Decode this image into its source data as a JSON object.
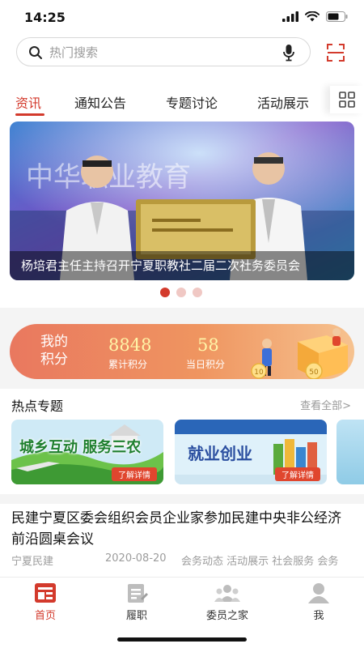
{
  "status": {
    "time": "14:25"
  },
  "search": {
    "placeholder": "热门搜索"
  },
  "tabs": [
    {
      "label": "资讯",
      "active": true
    },
    {
      "label": "通知公告",
      "active": false
    },
    {
      "label": "专题讨论",
      "active": false
    },
    {
      "label": "活动展示",
      "active": false
    }
  ],
  "banner": {
    "caption": "杨培君主任主持召开宁夏职教社二届二次社务委员会",
    "slide_count": 3,
    "active_slide": 1,
    "backdrop_text": "中华职业教育"
  },
  "points": {
    "label_line1": "我的",
    "label_line2": "积分",
    "total_value": "8848",
    "total_label": "累计积分",
    "today_value": "58",
    "today_label": "当日积分",
    "coin_10": "10",
    "coin_50": "50"
  },
  "hot": {
    "title": "热点专题",
    "more": "查看全部>",
    "cards": [
      {
        "title": "城乡互动 服务三农",
        "detail": "了解详情"
      },
      {
        "title": "就业创业",
        "detail": "了解详情"
      }
    ]
  },
  "news": {
    "title": "民建宁夏区委会组织会员企业家参加民建中央非公经济前沿圆桌会议",
    "source": "宁夏民建",
    "date": "2020-08-20",
    "tags": "会务动态 活动展示 社会服务 会务"
  },
  "tabbar": [
    {
      "label": "首页",
      "icon": "home-icon",
      "active": true
    },
    {
      "label": "履职",
      "icon": "duty-icon",
      "active": false
    },
    {
      "label": "委员之家",
      "icon": "members-icon",
      "active": false
    },
    {
      "label": "我",
      "icon": "profile-icon",
      "active": false
    }
  ],
  "colors": {
    "accent": "#d33a2c",
    "points_gradient_start": "#e9785f",
    "points_gradient_end": "#f6c28f"
  }
}
